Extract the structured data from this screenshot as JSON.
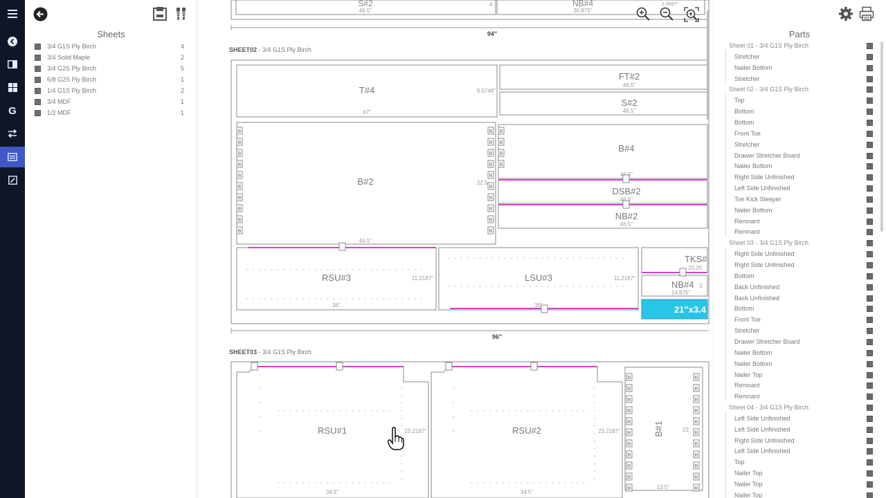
{
  "rail": {
    "items": [
      {
        "name": "menu-icon"
      },
      {
        "name": "back-circle-icon"
      },
      {
        "name": "layout-icon"
      },
      {
        "name": "grid-icon"
      },
      {
        "name": "g-icon",
        "glyph": "G"
      },
      {
        "name": "transfer-icon"
      },
      {
        "name": "list-icon",
        "active": true
      },
      {
        "name": "edit-icon"
      }
    ]
  },
  "sheets": {
    "title": "Sheets",
    "items": [
      {
        "label": "3/4 G1S Ply Birch",
        "count": "4"
      },
      {
        "label": "3/4 Solid Maple",
        "count": "2"
      },
      {
        "label": "3/4 G2S Ply Birch",
        "count": "5"
      },
      {
        "label": "5/8 G2S Ply Birch",
        "count": "1"
      },
      {
        "label": "1/4 G1S Ply Birch",
        "count": "2"
      },
      {
        "label": "3/4 MDF",
        "count": "1"
      },
      {
        "label": "1/2 MDF",
        "count": "1"
      }
    ]
  },
  "canvas": {
    "top_labels": {
      "s": "S#2",
      "s_dim": "46.5\"",
      "s_count": "4",
      "nb": "NB#4",
      "nb_dim": "30.875\"",
      "nb_right": "3.9687\"",
      "width": "94\""
    },
    "sheet02": {
      "name": "SHEET02",
      "material": " - 3/4 G1S Ply Birch",
      "width": "96\"",
      "parts": {
        "t4": "T#4",
        "t4_w": "47\"",
        "t4_h": "9.5748\"",
        "ft2": "FT#2",
        "ft2_w": "46.5\"",
        "s2": "S#2",
        "s2_w": "46.5\"",
        "b2": "B#2",
        "b2_w": "46.5\"",
        "b2_h": "22.5",
        "b4": "B#4",
        "b4_w": "46.5\"",
        "dsb2": "DSB#2",
        "dsb2_w": "46.5\"",
        "nb2": "NB#2",
        "nb2_w": "46.5\"",
        "rsu3": "RSU#3",
        "rsu3_w": "36\"",
        "rsu3_h": "11.2187\"",
        "lsu3": "LSU#3",
        "lsu3_w": "36\"",
        "lsu3_h": "11.2187\"",
        "tks": "TKS#",
        "tks_w": "20.25",
        "nb4": "NB#4",
        "nb4_w": "14.875\"",
        "nb4_h": "3",
        "remnant": "21\"x3.4"
      }
    },
    "sheet03": {
      "name": "SHEET03",
      "material": " - 3/4 G1S Ply Birch",
      "parts": {
        "rsu1": "RSU#1",
        "rsu1_w": "34.5\"",
        "rsu1_h": "23.2187\"",
        "rsu2": "RSU#2",
        "rsu2_w": "34.5\"",
        "rsu2_h": "23.2187\"",
        "b1": "B#1",
        "b1_w": "13.5\"",
        "b1_h": "22."
      }
    },
    "marker_b": "B",
    "marker_i": "I"
  },
  "parts": {
    "title": "Parts",
    "groups": [
      {
        "label": "Sheet 01 - 3/4 G1S Ply Birch",
        "items": [
          "Stretcher",
          "Nailer Bottom",
          "Stretcher"
        ]
      },
      {
        "label": "Sheet 02 - 3/4 G1S Ply Birch",
        "items": [
          "Top",
          "Bottom",
          "Bottom",
          "Front Toe",
          "Stretcher",
          "Drawer Stretcher Board",
          "Nailer Bottom",
          "Right Side Unfinished",
          "Left Side Unfinished",
          "Toe Kick Sleeper",
          "Nailer Bottom",
          "Remnant",
          "Remnant"
        ]
      },
      {
        "label": "Sheet 03 - 3/4 G1S Ply Birch",
        "items": [
          "Right Side Unfinished",
          "Right Side Unfinished",
          "Bottom",
          "Back Unfinished",
          "Back Unfinished",
          "Bottom",
          "Front Toe",
          "Stretcher",
          "Drawer Stretcher Board",
          "Nailer Bottom",
          "Nailer Bottom",
          "Nailer Top",
          "Remnant",
          "Remnant"
        ]
      },
      {
        "label": "Sheet 04 - 3/4 G1S Ply Birch",
        "items": [
          "Left Side Unfinished",
          "Left Side Unfinished",
          "Right Side Unfinished",
          "Left Side Unfinished",
          "Top",
          "Nailer Top",
          "Nailer Top",
          "Nailer Top"
        ]
      }
    ]
  },
  "colors": {
    "rail_bg": "#0f1628",
    "rail_active": "#3f57c7",
    "edgeband": "#d63fd6",
    "remnant": "#29c5e6",
    "part_stroke": "#8a8a8a"
  }
}
